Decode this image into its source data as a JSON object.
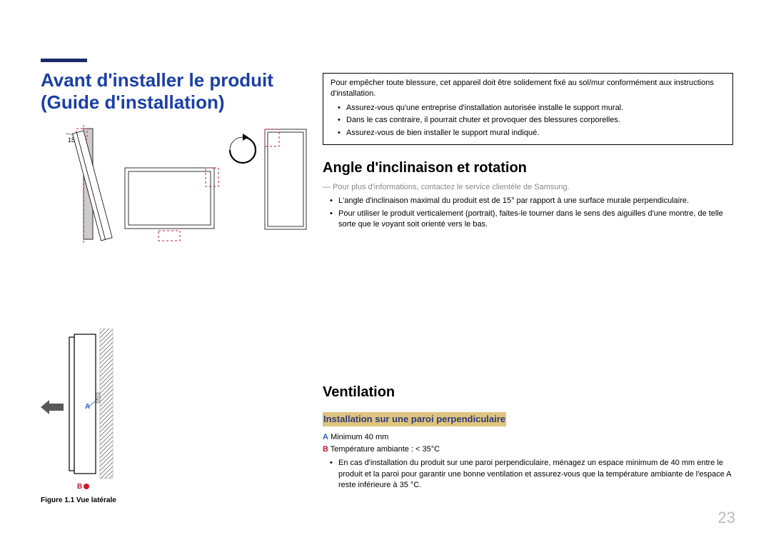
{
  "title": "Avant d'installer le produit (Guide d'installation)",
  "warning_box": {
    "lead": "Pour empêcher toute blessure, cet appareil doit être solidement fixé au sol/mur conformément aux instructions d'installation.",
    "items": [
      "Assurez-vous qu'une entreprise d'installation autorisée installe le support mural.",
      "Dans le cas contraire, il pourrait chuter et provoquer des blessures corporelles.",
      "Assurez-vous de bien installer le support mural indiqué."
    ]
  },
  "tilt": {
    "heading": "Angle d'inclinaison et rotation",
    "note": "Pour plus d'informations, contactez le service clientèle de Samsung.",
    "items": [
      "L'angle d'inclinaison maximal du produit est de 15° par rapport à une surface murale perpendiculaire.",
      "Pour utiliser le produit verticalement (portrait), faites-le tourner dans le sens des aiguilles d'une montre, de telle sorte que le voyant soit orienté vers le bas."
    ]
  },
  "vent": {
    "heading": "Ventilation",
    "subheading": "Installation sur une paroi perpendiculaire",
    "specA_label": "A",
    "specA": " Minimum 40 mm",
    "specB_label": "B",
    "specB": " Température ambiante : < 35°C",
    "items": [
      "En cas d'installation du produit sur une paroi perpendiculaire, ménagez un espace minimum de 40 mm entre le produit et la paroi pour garantir une bonne ventilation et assurez-vous que la température ambiante de l'espace A reste inférieure à 35 °C."
    ]
  },
  "fig1": {
    "angle_label": "15"
  },
  "fig2": {
    "labelA": "A",
    "labelB": "B",
    "caption": "Figure 1.1 Vue latérale"
  },
  "page_number": "23"
}
